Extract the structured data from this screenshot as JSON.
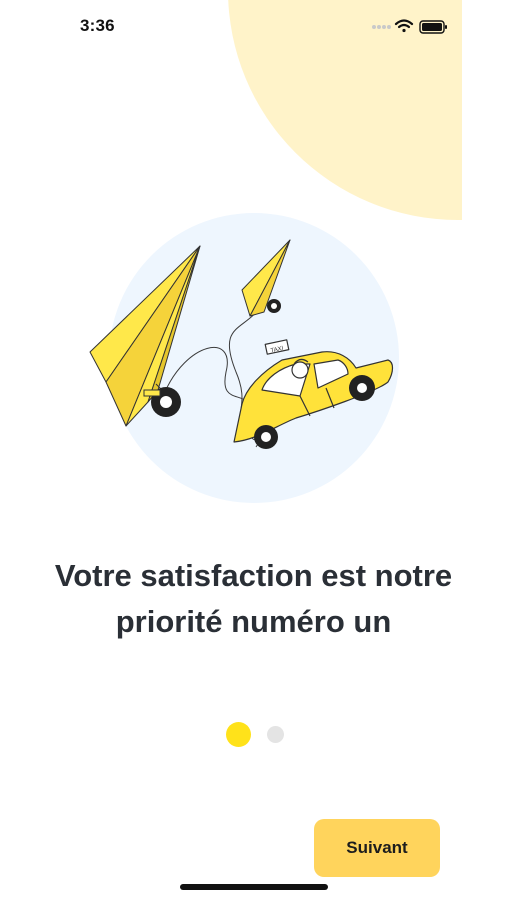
{
  "status_bar": {
    "time": "3:36",
    "icons": [
      "signal-dots-icon",
      "wifi-icon",
      "battery-icon"
    ]
  },
  "onboarding": {
    "title": "Votre satisfaction est notre priorité numéro un",
    "taxi_sign": "TAXI",
    "page_indicator": {
      "total": 2,
      "current": 1
    },
    "next_label": "Suivant"
  },
  "colors": {
    "accent": "#FFD45C",
    "active_dot": "#FFE21A",
    "inactive_dot": "#E4E4E4",
    "blob": "#FFF3C9",
    "circle": "#EEF6FE",
    "taxi_yellow": "#FFE23A"
  }
}
